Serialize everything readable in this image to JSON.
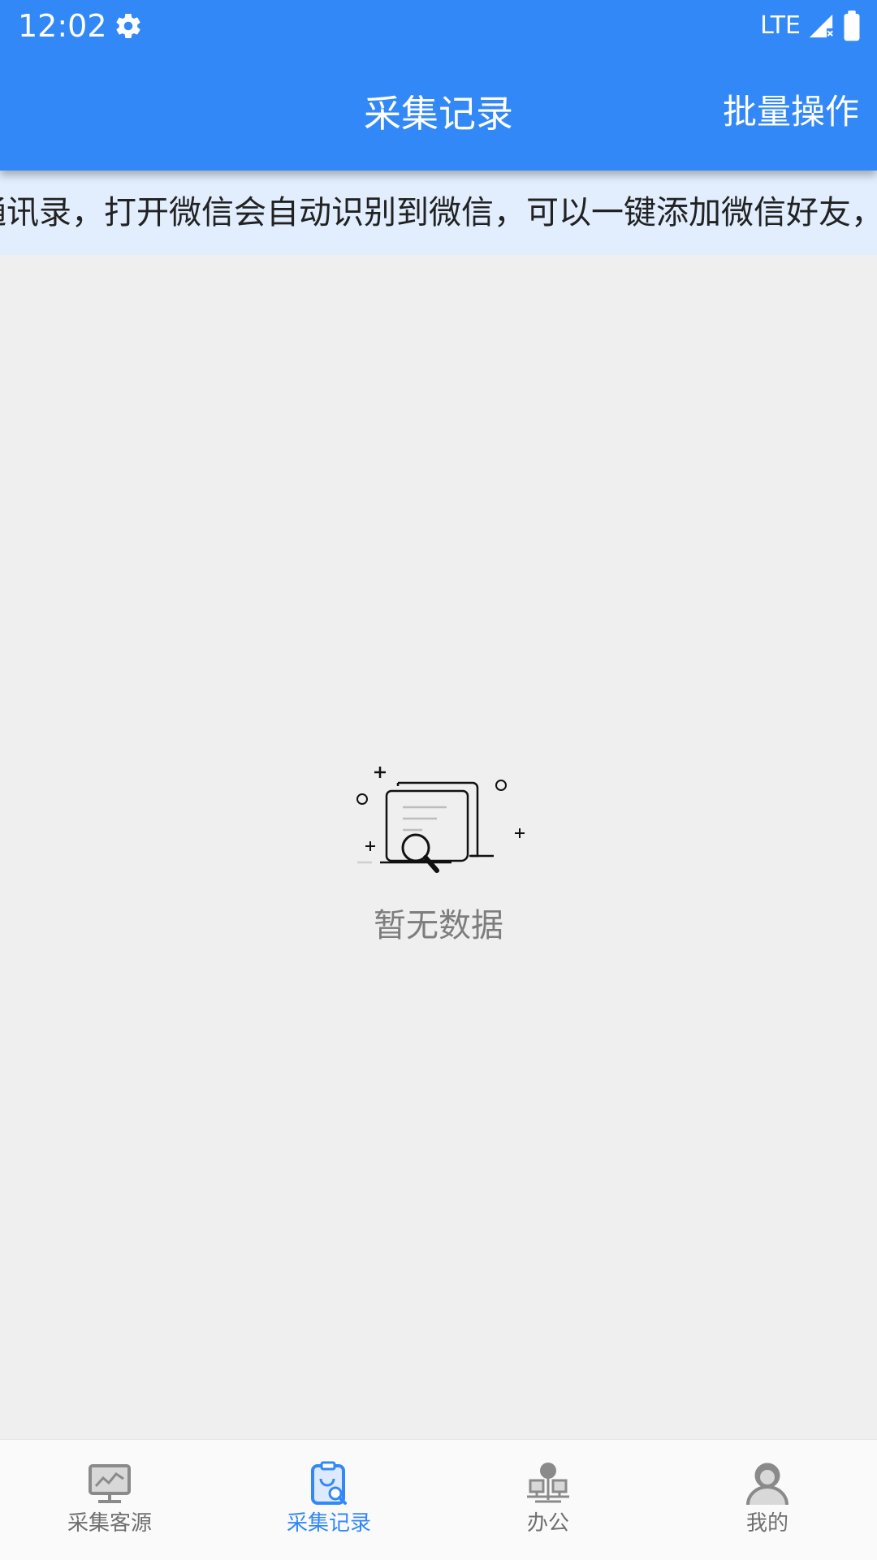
{
  "status_bar": {
    "time": "12:02",
    "network": "LTE",
    "icons": [
      "settings-gear-icon",
      "signal-icon",
      "battery-icon"
    ]
  },
  "header": {
    "title": "采集记录",
    "action_label": "批量操作",
    "background": "#3388f8"
  },
  "notice": {
    "text": "通讯录，打开微信会自动识别到微信，可以一键添加微信好友，"
  },
  "empty_state": {
    "text": "暂无数据",
    "icon": "documents-search-icon"
  },
  "bottom_nav": {
    "active_color": "#3388f8",
    "items": [
      {
        "label": "采集客源",
        "icon": "monitor-chart-icon",
        "active": false
      },
      {
        "label": "采集记录",
        "icon": "clipboard-search-icon",
        "active": true
      },
      {
        "label": "办公",
        "icon": "office-network-icon",
        "active": false
      },
      {
        "label": "我的",
        "icon": "user-icon",
        "active": false
      }
    ]
  }
}
